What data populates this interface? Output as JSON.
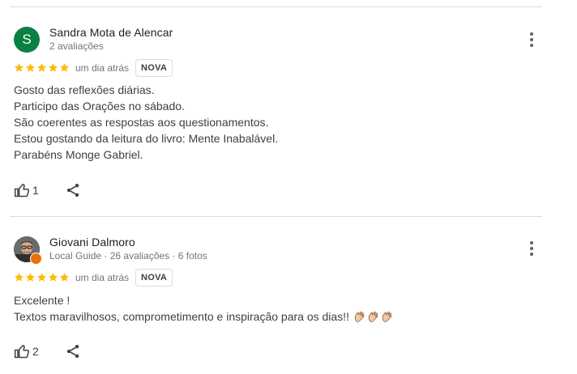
{
  "reviews": [
    {
      "author": "Sandra Mota de Alencar",
      "avatar_letter": "S",
      "meta": "2 avaliações",
      "rating": 5,
      "time": "um dia atrás",
      "badge": "NOVA",
      "text_lines": [
        "Gosto das reflexões diárias.",
        "Participo das Orações no sábado.",
        "São coerentes as respostas aos questionamentos.",
        "Estou gostando da leitura do livro: Mente Inabalável.",
        "Parabéns Monge Gabriel."
      ],
      "like_count": "1"
    },
    {
      "author": "Giovani Dalmoro",
      "meta": "Local Guide · 26 avaliações · 6 fotos",
      "rating": 5,
      "time": "um dia atrás",
      "badge": "NOVA",
      "text_lines": [
        "Excelente !",
        "Textos maravilhosos, comprometimento e inspiração para os dias!!"
      ],
      "emoji": "clapping-hands x3",
      "like_count": "2"
    }
  ],
  "icons": {
    "more": "more-vert-icon",
    "like": "thumb-up-icon",
    "share": "share-icon",
    "star": "star-icon"
  },
  "colors": {
    "star": "#fbbc04",
    "avatar_sandra": "#0b8043",
    "local_guide_badge": "#e8710a",
    "divider": "#dadce0"
  }
}
